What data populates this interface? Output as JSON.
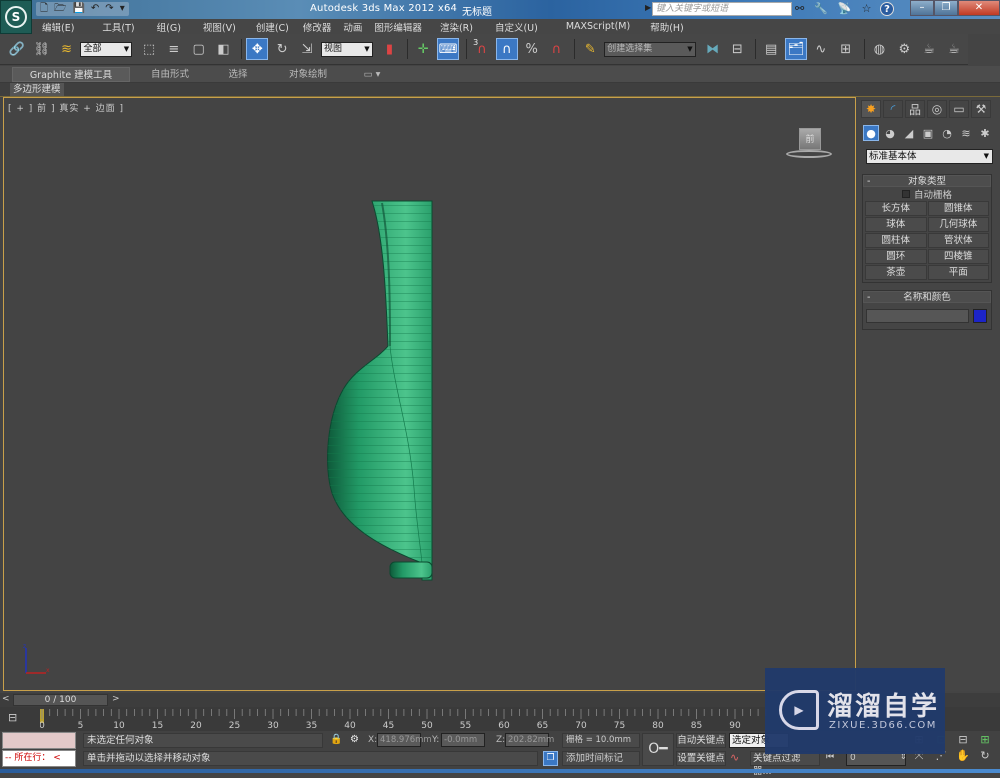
{
  "titlebar": {
    "app_title": "Autodesk 3ds Max  2012 x64",
    "file_name": "无标题",
    "search_placeholder": "键入关键字或短语",
    "logo": "S",
    "quick_access": [
      "new-file-icon",
      "open-file-icon",
      "save-icon",
      "undo-icon",
      "redo-icon",
      "customize-arrow-icon"
    ],
    "quick_access_glyphs": [
      "🗋",
      "🗁",
      "💾",
      "↶",
      "↷",
      "▾"
    ],
    "info_icons": [
      "binoculars-icon",
      "wrench-icon",
      "satellite-icon",
      "star-icon"
    ],
    "info_glyphs": [
      "⚯",
      "🔧",
      "📡",
      "☆"
    ],
    "help": "?",
    "window_buttons": {
      "minimize": "–",
      "restore": "❐",
      "close": "✕"
    }
  },
  "menubar": {
    "items": [
      "编辑(E)",
      "工具(T)",
      "组(G)",
      "视图(V)",
      "创建(C)",
      "修改器",
      "动画",
      "图形编辑器",
      "渲染(R)",
      "自定义(U)",
      "MAXScript(M)",
      "帮助(H)"
    ]
  },
  "toolbar": {
    "selection_filter": "全部",
    "reference_coord": "视图",
    "named_selection": "创建选择集",
    "snap_label": "3",
    "tools": {
      "link": "🔗",
      "unlink": "⛓",
      "bind_space_warp": "≋",
      "select_object": "⬚",
      "select_by_name": "≡",
      "rect_region": "▢",
      "window_crossing": "◧",
      "move": "✥",
      "rotate": "↻",
      "scale": "⇲",
      "pivot": "▮",
      "manipulate": "✛",
      "keyboard_shortcut": "⌨",
      "snap_toggle": "∩",
      "angle_snap": "∩",
      "percent_snap": "%",
      "spinner_snap": "∩",
      "edit_named": "✎",
      "mirror": "⧓",
      "align": "⊟",
      "layer_manager": "▤",
      "scene_explorer": "🗂",
      "curve_editor": "∿",
      "schematic": "⊞",
      "material_editor": "◍",
      "render_setup": "⚙",
      "render_frame": "☕",
      "render": "☕"
    }
  },
  "ribbon": {
    "tabs": [
      "Graphite 建模工具",
      "自由形式",
      "选择",
      "对象绘制"
    ],
    "toggle": "▭ ▾",
    "sub_tab": "多边形建模"
  },
  "viewport": {
    "label": "[ + ] 前 ] 真实 + 边面 ]",
    "viewcube_face": "前",
    "object_color": "#2fa572"
  },
  "command_panel": {
    "tabs": [
      "create-tab",
      "modify-tab",
      "hierarchy-tab",
      "motion-tab",
      "display-tab",
      "utilities-tab"
    ],
    "tab_glyphs": [
      "✸",
      "◜",
      "品",
      "◎",
      "▭",
      "⚒"
    ],
    "sub_icons": [
      "geometry-icon",
      "shapes-icon",
      "lights-icon",
      "cameras-icon",
      "helpers-icon",
      "spacewarps-icon",
      "systems-icon"
    ],
    "sub_glyphs": [
      "●",
      "◕",
      "◢",
      "▣",
      "◔",
      "≋",
      "✱"
    ],
    "category": "标准基本体",
    "object_type": {
      "title": "对象类型",
      "auto_grid": "自动栅格",
      "buttons": [
        "长方体",
        "圆锥体",
        "球体",
        "几何球体",
        "圆柱体",
        "管状体",
        "圆环",
        "四棱锥",
        "茶壶",
        "平面"
      ]
    },
    "name_color": {
      "title": "名称和颜色",
      "name_value": "",
      "color": "#1c24c8"
    }
  },
  "timeline": {
    "slider_text": "0 / 100",
    "prev": "<",
    "next": ">",
    "ticks": [
      "0",
      "5",
      "10",
      "15",
      "20",
      "25",
      "30",
      "35",
      "40",
      "45",
      "50",
      "55",
      "60",
      "65",
      "70",
      "75",
      "80",
      "85",
      "90"
    ],
    "current_frame": 0
  },
  "statusbar": {
    "maxscript_label": "--  所在行：  <",
    "selection_status": "未选定任何对象",
    "prompt": "单击并拖动以选择并移动对象",
    "x_label": "X:",
    "x_value": "418.976mm",
    "y_label": "Y:",
    "y_value": "-0.0mm",
    "z_label": "Z:",
    "z_value": "202.82mm",
    "grid": "栅格 = 10.0mm",
    "add_time_tag": "添加时间标记",
    "auto_key": "自动关键点",
    "set_key": "设置关键点",
    "selected_set": "选定对象",
    "key_filters": "关键点过滤器...",
    "frame_value": "0",
    "key_glyph": "O━",
    "lock_glyph": "🔒",
    "absolute_glyph": "⚙",
    "nav_glyphs": [
      "⊞",
      "⊡",
      "⊟",
      "⊞",
      "⤧",
      "⋰",
      "✋",
      "↻",
      "⧉"
    ]
  },
  "watermark": {
    "brand_cn": "溜溜自学",
    "brand_en": "ZIXUE.3D66.COM",
    "logo_glyph": "▶"
  }
}
